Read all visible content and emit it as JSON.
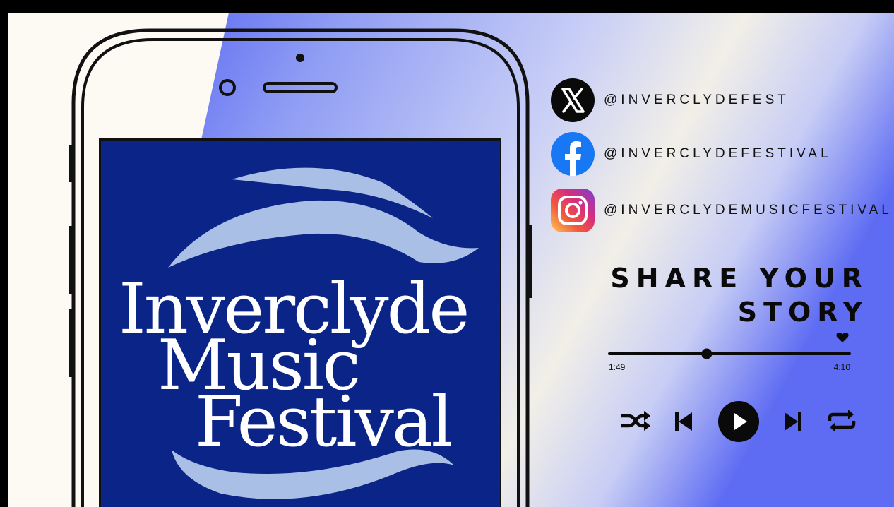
{
  "social": {
    "x": {
      "icon": "x-logo-icon",
      "handle": "@INVERCLYDEFEST"
    },
    "facebook": {
      "icon": "facebook-logo-icon",
      "handle": "@INVERCLYDEFESTIVAL"
    },
    "instagram": {
      "icon": "instagram-logo-icon",
      "handle": "@INVERCLYDEMUSICFESTIVAL"
    }
  },
  "headline": {
    "line1": "SHARE YOUR",
    "line2": "STORY"
  },
  "logo": {
    "line1": "Inverclyde",
    "line2": "Music",
    "line3": "Festival"
  },
  "player": {
    "elapsed": "1:49",
    "total": "4:10",
    "progress": 0.4,
    "liked": true,
    "controls": [
      "shuffle-icon",
      "previous-icon",
      "play-icon",
      "next-icon",
      "repeat-icon"
    ]
  },
  "colors": {
    "logo_blue": "#0b2487",
    "wave_light": "#a9bfe6",
    "gradient_blue": "#5b6af0",
    "text": "#0a0a0a"
  }
}
